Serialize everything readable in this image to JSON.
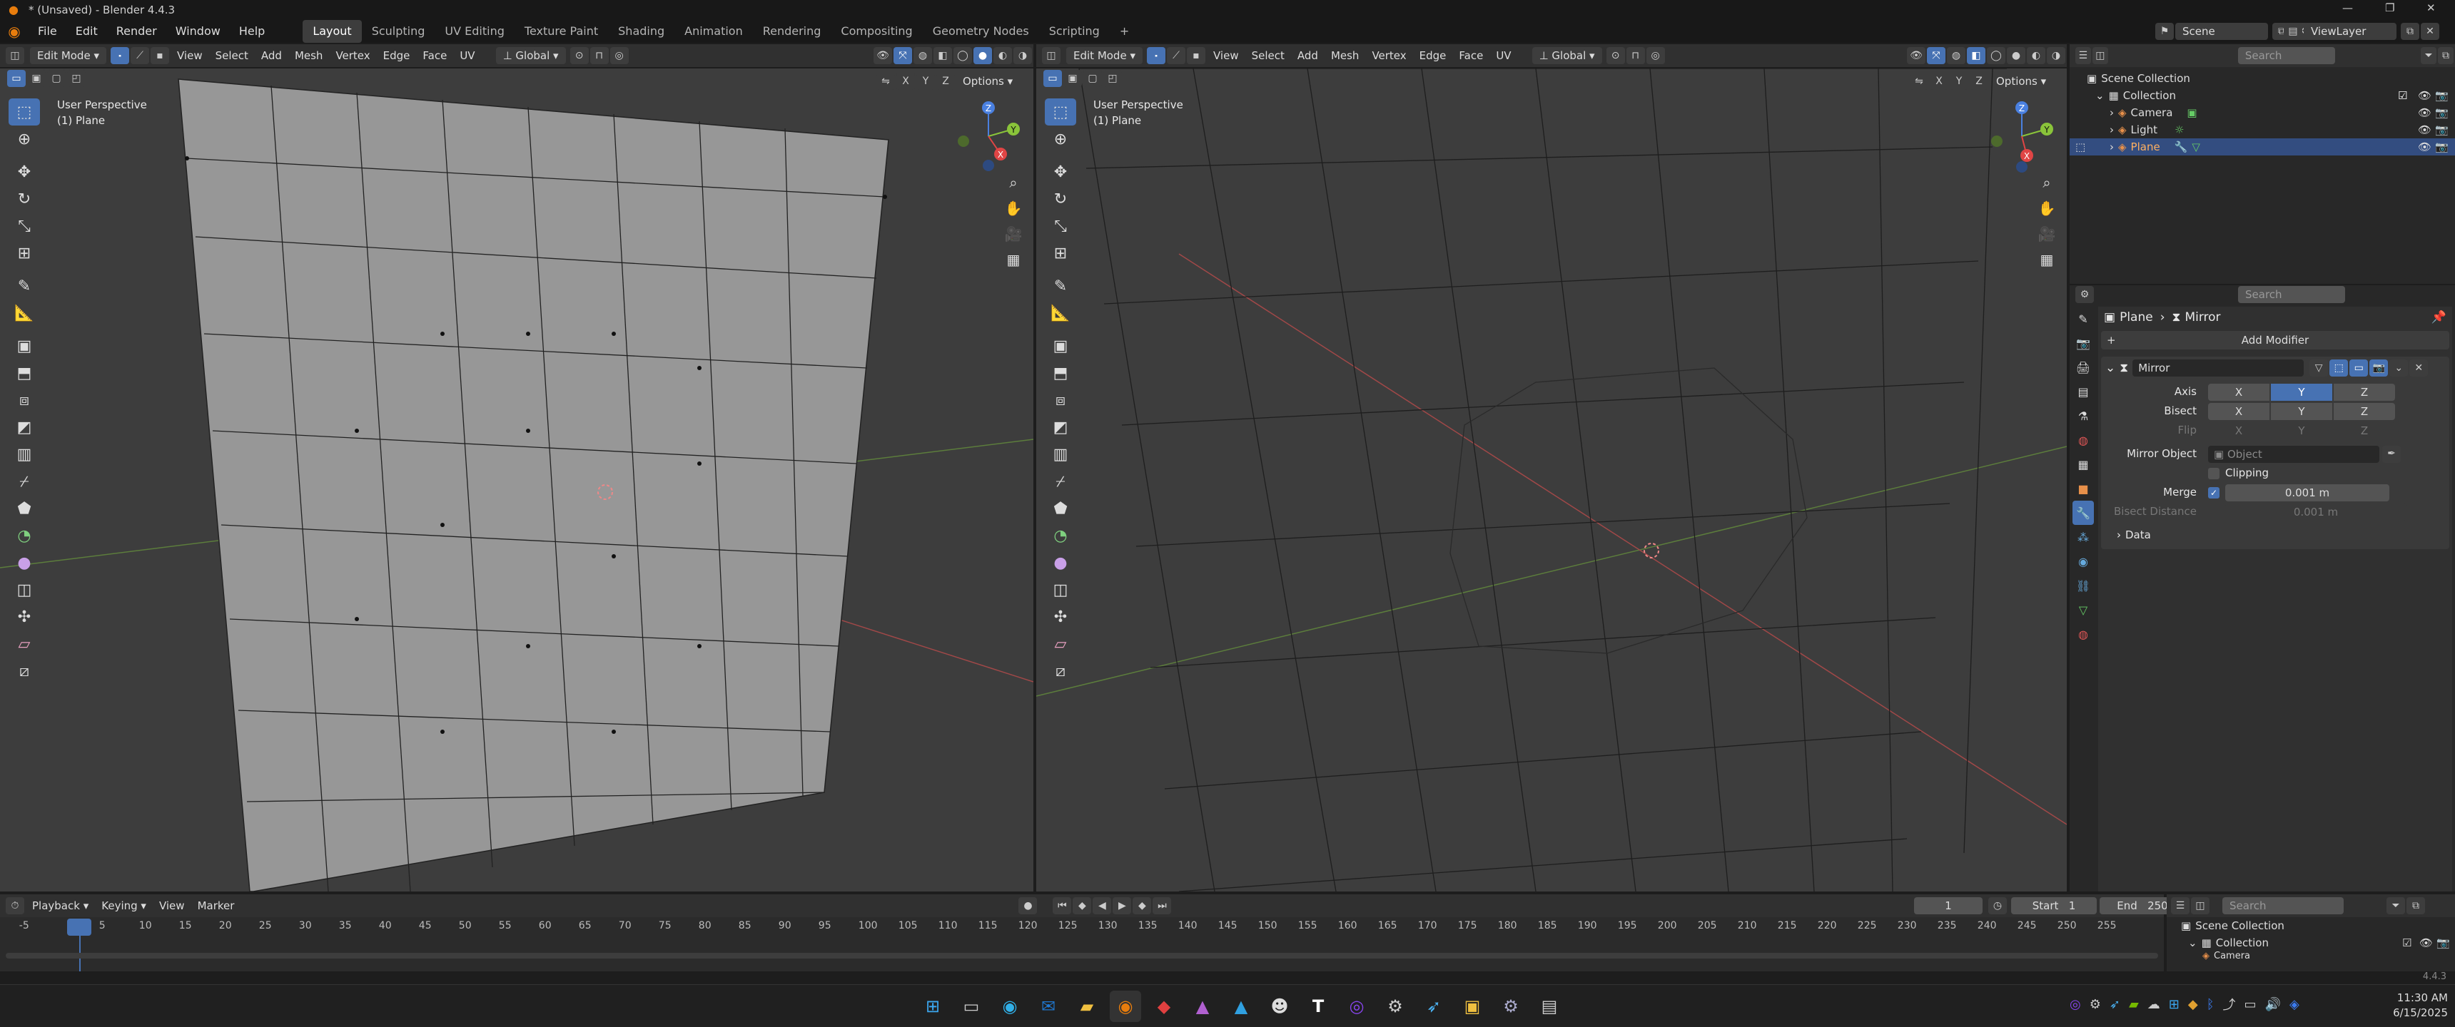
{
  "window": {
    "title": "* (Unsaved) - Blender 4.4.3"
  },
  "menu": [
    "File",
    "Edit",
    "Render",
    "Window",
    "Help"
  ],
  "workspaces": [
    "Layout",
    "Sculpting",
    "UV Editing",
    "Texture Paint",
    "Shading",
    "Animation",
    "Rendering",
    "Compositing",
    "Geometry Nodes",
    "Scripting",
    "+"
  ],
  "scene": {
    "label": "Scene",
    "viewlayer": "ViewLayer"
  },
  "viewport_left": {
    "mode": "Edit Mode",
    "menus": [
      "View",
      "Select",
      "Add",
      "Mesh",
      "Vertex",
      "Edge",
      "Face",
      "UV"
    ],
    "orientation": "Global",
    "options": "Options",
    "axes": [
      "X",
      "Y",
      "Z"
    ],
    "overlay_title": "User Perspective",
    "overlay_object": "(1) Plane"
  },
  "viewport_right": {
    "mode": "Edit Mode",
    "menus": [
      "View",
      "Select",
      "Add",
      "Mesh",
      "Vertex",
      "Edge",
      "Face",
      "UV"
    ],
    "orientation": "Global",
    "options": "Options",
    "axes": [
      "X",
      "Y",
      "Z"
    ],
    "overlay_title": "User Perspective",
    "overlay_object": "(1) Plane"
  },
  "gizmo": {
    "x": "X",
    "y": "Y",
    "z": "Z"
  },
  "outliner": {
    "search_placeholder": "Search",
    "root": "Scene Collection",
    "items": [
      {
        "label": "Collection",
        "indent": 1
      },
      {
        "label": "Camera",
        "indent": 2
      },
      {
        "label": "Light",
        "indent": 2
      },
      {
        "label": "Plane",
        "indent": 2,
        "selected": true
      }
    ]
  },
  "properties": {
    "search_placeholder": "Search",
    "breadcrumb_object": "Plane",
    "breadcrumb_modifier": "Mirror",
    "add_modifier": "Add Modifier",
    "modifier_name": "Mirror",
    "axis_label": "Axis",
    "bisect_label": "Bisect",
    "flip_label": "Flip",
    "axis_values": [
      "X",
      "Y",
      "Z"
    ],
    "axis_active": "Y",
    "mirror_object_label": "Mirror Object",
    "mirror_object_placeholder": "Object",
    "clipping_label": "Clipping",
    "merge_label": "Merge",
    "merge_value": "0.001 m",
    "bisect_distance_label": "Bisect Distance",
    "bisect_distance_value": "0.001 m",
    "data_label": "Data"
  },
  "timeline": {
    "menus": [
      "Playback",
      "Keying",
      "View",
      "Marker"
    ],
    "current_frame": "1",
    "start_label": "Start",
    "start_value": "1",
    "end_label": "End",
    "end_value": "250",
    "ticks": [
      "-5",
      "1",
      "5",
      "10",
      "15",
      "20",
      "25",
      "30",
      "35",
      "40",
      "45",
      "50",
      "55",
      "60",
      "65",
      "70",
      "75",
      "80",
      "85",
      "90",
      "95",
      "100",
      "105",
      "110",
      "115",
      "120",
      "125",
      "130",
      "135",
      "140",
      "145",
      "150",
      "155",
      "160",
      "165",
      "170",
      "175",
      "180",
      "185",
      "190",
      "195",
      "200",
      "205",
      "210",
      "215",
      "220",
      "225",
      "230",
      "235",
      "240",
      "245",
      "250",
      "255"
    ]
  },
  "outliner2": {
    "search_placeholder": "Search",
    "root": "Scene Collection",
    "collection": "Collection",
    "camera": "Camera"
  },
  "version": "4.4.3",
  "clock": {
    "time": "11:30 AM",
    "date": "6/15/2025"
  }
}
